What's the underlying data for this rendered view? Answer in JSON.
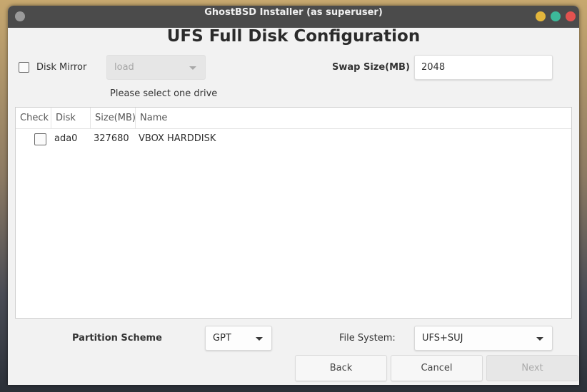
{
  "window": {
    "title": "GhostBSD Installer (as superuser)"
  },
  "page": {
    "heading": "UFS Full Disk Configuration"
  },
  "mirror": {
    "checkbox_label": "Disk Mirror",
    "checked": false,
    "select_value": "load",
    "hint": "Please select one drive"
  },
  "swap": {
    "label": "Swap Size(MB)",
    "value": "2048"
  },
  "disk_table": {
    "columns": [
      "Check",
      "Disk",
      "Size(MB)",
      "Name"
    ],
    "rows": [
      {
        "checked": false,
        "disk": "ada0",
        "size": "327680",
        "name": "VBOX HARDDISK"
      }
    ]
  },
  "partition_scheme": {
    "label": "Partition Scheme",
    "value": "GPT"
  },
  "file_system": {
    "label": "File System:",
    "value": "UFS+SUJ"
  },
  "buttons": {
    "back": "Back",
    "cancel": "Cancel",
    "next": "Next"
  },
  "colors": {
    "titlebar": "#4b4b4b",
    "minimize": "#e3b63c",
    "maximize": "#3cb89a",
    "close": "#e2524f"
  }
}
